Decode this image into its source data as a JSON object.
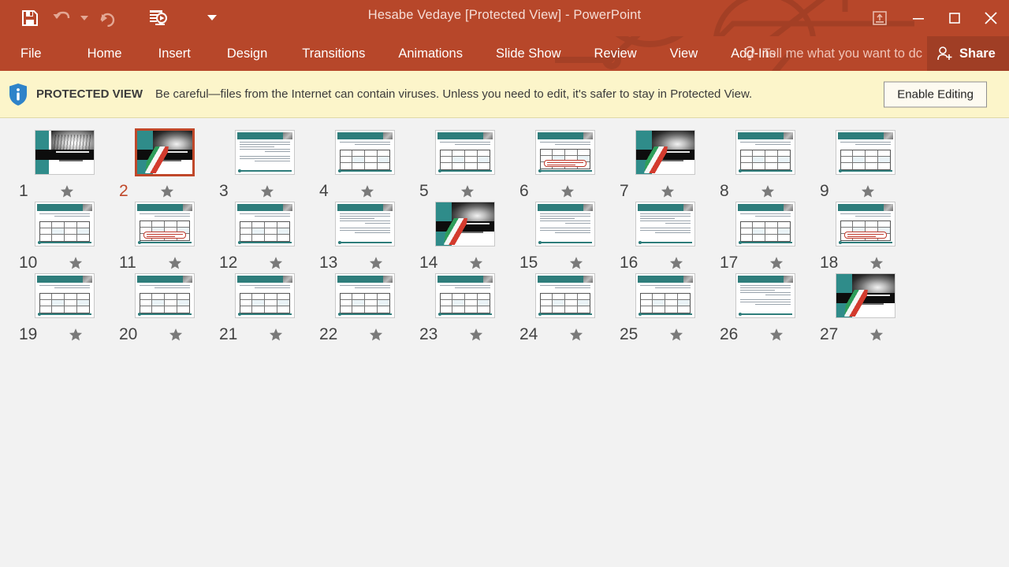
{
  "window": {
    "title": "Hesabe Vedaye [Protected View] - PowerPoint",
    "accent_color": "#b7472a",
    "share_bg": "#a03e25"
  },
  "quick_access": {
    "items": [
      {
        "name": "save-icon",
        "label": "Save"
      },
      {
        "name": "undo-icon",
        "label": "Undo"
      },
      {
        "name": "undo-dropdown-caret",
        "label": "Undo options"
      },
      {
        "name": "redo-icon",
        "label": "Redo"
      },
      {
        "name": "start-slideshow-icon",
        "label": "Start From Beginning"
      },
      {
        "name": "customize-qat-caret",
        "label": "Customize Quick Access Toolbar"
      }
    ]
  },
  "window_controls": {
    "ribbon_display": "Ribbon Display Options",
    "minimize": "Minimize",
    "restore": "Restore Down",
    "close": "Close"
  },
  "ribbon": {
    "tabs": [
      {
        "label": "File",
        "active": false
      },
      {
        "label": "Home",
        "active": false
      },
      {
        "label": "Insert",
        "active": false
      },
      {
        "label": "Design",
        "active": false
      },
      {
        "label": "Transitions",
        "active": false
      },
      {
        "label": "Animations",
        "active": false
      },
      {
        "label": "Slide Show",
        "active": false
      },
      {
        "label": "Review",
        "active": false
      },
      {
        "label": "View",
        "active": false
      },
      {
        "label": "Add-Ins",
        "active": false
      }
    ],
    "tell_me": "Tell me what you want to dc",
    "share": "Share"
  },
  "protected_view": {
    "label": "PROTECTED VIEW",
    "message": "Be careful—files from the Internet can contain viruses. Unless you need to edit, it's safer to stay in Protected View.",
    "button": "Enable Editing",
    "bg_color": "#fcf5ca"
  },
  "slide_sorter": {
    "selected_slide": 2,
    "selection_color": "#c0482a",
    "slides": [
      {
        "number": "1",
        "kind": "title",
        "starred": true
      },
      {
        "number": "2",
        "kind": "divider",
        "starred": true
      },
      {
        "number": "3",
        "kind": "text",
        "starred": true
      },
      {
        "number": "4",
        "kind": "table",
        "starred": true
      },
      {
        "number": "5",
        "kind": "table",
        "starred": true
      },
      {
        "number": "6",
        "kind": "table-red",
        "starred": true
      },
      {
        "number": "7",
        "kind": "divider",
        "starred": true
      },
      {
        "number": "8",
        "kind": "table",
        "starred": true
      },
      {
        "number": "9",
        "kind": "table",
        "starred": true
      },
      {
        "number": "10",
        "kind": "table",
        "starred": true
      },
      {
        "number": "11",
        "kind": "table-red",
        "starred": true
      },
      {
        "number": "12",
        "kind": "table",
        "starred": true
      },
      {
        "number": "13",
        "kind": "text",
        "starred": true
      },
      {
        "number": "14",
        "kind": "divider",
        "starred": true
      },
      {
        "number": "15",
        "kind": "text",
        "starred": true
      },
      {
        "number": "16",
        "kind": "text",
        "starred": true
      },
      {
        "number": "17",
        "kind": "table",
        "starred": true
      },
      {
        "number": "18",
        "kind": "table-red",
        "starred": true
      },
      {
        "number": "19",
        "kind": "table",
        "starred": true
      },
      {
        "number": "20",
        "kind": "table",
        "starred": true
      },
      {
        "number": "21",
        "kind": "table",
        "starred": true
      },
      {
        "number": "22",
        "kind": "table",
        "starred": true
      },
      {
        "number": "23",
        "kind": "table",
        "starred": true
      },
      {
        "number": "24",
        "kind": "table",
        "starred": true
      },
      {
        "number": "25",
        "kind": "table",
        "starred": true
      },
      {
        "number": "26",
        "kind": "text",
        "starred": true
      },
      {
        "number": "27",
        "kind": "divider",
        "starred": true
      }
    ]
  }
}
